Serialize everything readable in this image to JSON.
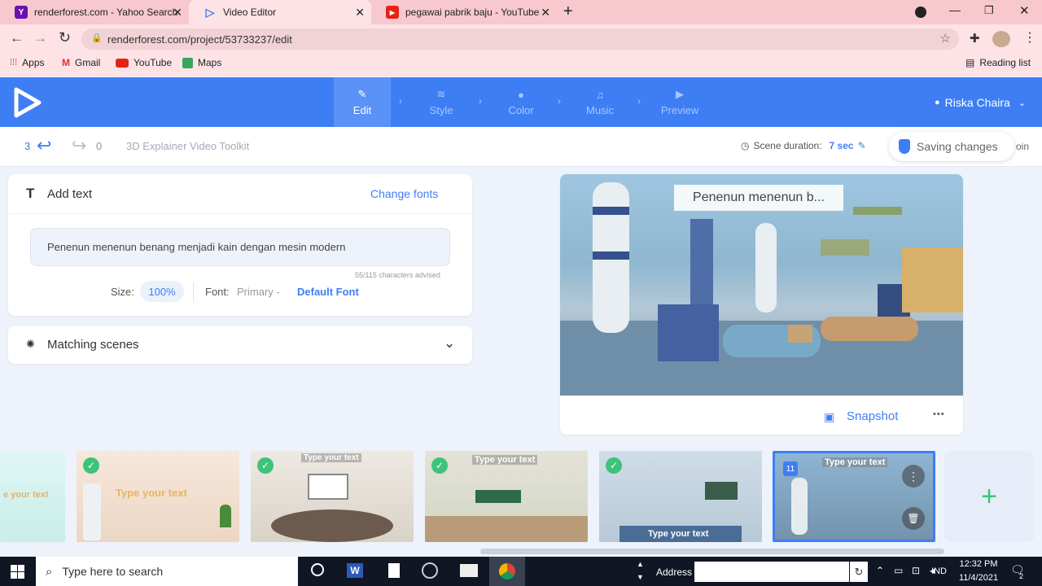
{
  "browser": {
    "tabs": [
      {
        "title": "renderforest.com - Yahoo Search",
        "favicon": "yahoo-icon"
      },
      {
        "title": "Video Editor",
        "favicon": "renderforest-icon"
      },
      {
        "title": "pegawai pabrik baju - YouTube",
        "favicon": "youtube-icon"
      }
    ],
    "new_tab": "+",
    "url": "renderforest.com/project/53733237/edit",
    "bookmarks": [
      "Apps",
      "Gmail",
      "YouTube",
      "Maps"
    ],
    "reading_list": "Reading list"
  },
  "app": {
    "steps": [
      {
        "label": "Edit",
        "icon": "pencil-icon"
      },
      {
        "label": "Style",
        "icon": "layers-icon"
      },
      {
        "label": "Color",
        "icon": "palette-icon"
      },
      {
        "label": "Music",
        "icon": "music-icon"
      },
      {
        "label": "Preview",
        "icon": "play-icon"
      }
    ],
    "user": "Riska Chaira",
    "accent": "#3e7ef5"
  },
  "subheader": {
    "undo_count": "3",
    "redo_count": "0",
    "project_name": "3D Explainer Video Toolkit",
    "scene_duration_label": "Scene duration:",
    "scene_duration_value": "7 sec",
    "saving": "Saving changes",
    "cut_text": "oin"
  },
  "add_text": {
    "title": "Add text",
    "change_fonts": "Change fonts",
    "text_value": "Penenun menenun benang menjadi kain dengan mesin modern",
    "char_hint": "55/115 characters advised",
    "size_label": "Size:",
    "size_value": "100%",
    "font_label": "Font:",
    "font_primary": "Primary -",
    "font_value": "Default Font"
  },
  "matching": {
    "title": "Matching scenes"
  },
  "preview": {
    "overlay_text": "Penenun menenun b...",
    "snapshot": "Snapshot",
    "more": "•••"
  },
  "timeline": {
    "thumbs": [
      {
        "text": "e your text",
        "checked": false
      },
      {
        "text": "Type your text",
        "checked": true
      },
      {
        "text": "Type your text",
        "checked": true
      },
      {
        "text": "Type your text",
        "checked": true
      },
      {
        "text": "Type your text",
        "checked": true
      },
      {
        "text": "Type your text",
        "checked": false,
        "active": true,
        "badge": "11"
      }
    ],
    "add": "+"
  },
  "taskbar": {
    "search": "Type here to search",
    "address_label": "Address",
    "lang": "IND",
    "time": "12:32 PM",
    "date": "11/4/2021",
    "notif_count": "2"
  }
}
